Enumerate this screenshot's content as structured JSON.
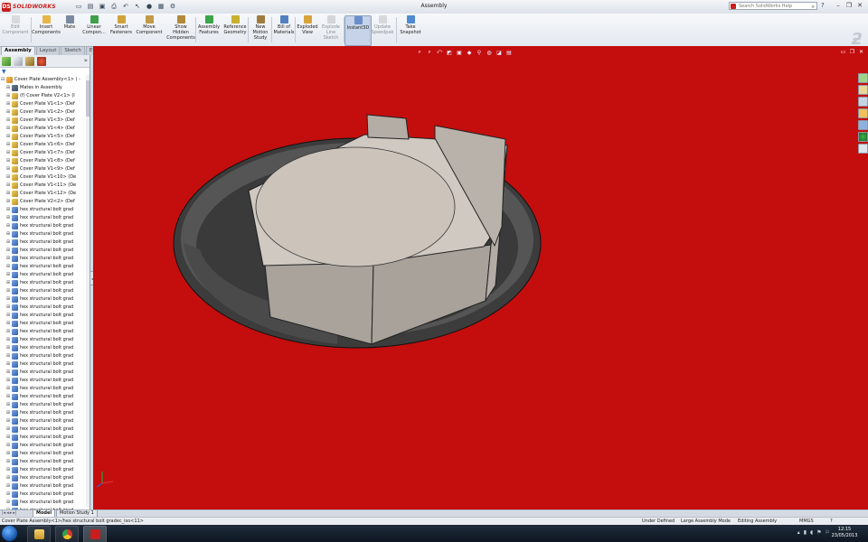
{
  "app": {
    "name": "SOLIDWORKS",
    "doc_title": "Assembly",
    "help_search_placeholder": "Search SolidWorks Help"
  },
  "commands": [
    {
      "id": "edit-component",
      "label": "Edit Component",
      "icon": "edit-component-icon",
      "disabled": true
    },
    {
      "id": "insert-components",
      "label": "Insert Components",
      "icon": "insert-components-icon"
    },
    {
      "id": "mate",
      "label": "Mate",
      "icon": "mate-icon"
    },
    {
      "id": "linear-component",
      "label": "Linear Compon...",
      "icon": "linear-pattern-icon"
    },
    {
      "id": "smart-fasteners",
      "label": "Smart Fasteners",
      "icon": "smart-fasteners-icon"
    },
    {
      "id": "move-component",
      "label": "Move Component",
      "icon": "move-component-icon"
    },
    {
      "id": "show-hidden",
      "label": "Show Hidden Components",
      "icon": "show-hidden-icon"
    },
    {
      "id": "assembly-features",
      "label": "Assembly Features",
      "icon": "assembly-features-icon"
    },
    {
      "id": "reference-geometry",
      "label": "Reference Geometry",
      "icon": "reference-geometry-icon"
    },
    {
      "id": "new-motion-study",
      "label": "New Motion Study",
      "icon": "motion-study-icon"
    },
    {
      "id": "bill-of-materials",
      "label": "Bill of Materials",
      "icon": "bom-icon"
    },
    {
      "id": "exploded-view",
      "label": "Exploded View",
      "icon": "exploded-view-icon"
    },
    {
      "id": "explode-line-sketch",
      "label": "Explode Line Sketch",
      "icon": "explode-line-icon",
      "disabled": true
    },
    {
      "id": "instant3d",
      "label": "Instant3D",
      "icon": "instant3d-icon",
      "active": true
    },
    {
      "id": "update-speedpak",
      "label": "Update Speedpak",
      "icon": "speedpak-icon",
      "disabled": true
    },
    {
      "id": "take-snapshot",
      "label": "Take Snapshot",
      "icon": "snapshot-icon"
    }
  ],
  "tabs": [
    "Assembly",
    "Layout",
    "Sketch",
    "Evaluate",
    "Office Products"
  ],
  "tree": {
    "root": "Cover Plate Assembly<1> ( -",
    "items": [
      {
        "label": "Mates in Assembly",
        "type": "mates"
      },
      {
        "label": "(f) Cover Plate V2<1> (I",
        "type": "part"
      },
      {
        "label": "Cover Plate V1<1> (Def",
        "type": "part"
      },
      {
        "label": "Cover Plate V1<2> (Def",
        "type": "part"
      },
      {
        "label": "Cover Plate V1<3> (Def",
        "type": "part"
      },
      {
        "label": "Cover Plate V1<4> (Def",
        "type": "part"
      },
      {
        "label": "Cover Plate V1<5> (Def",
        "type": "part"
      },
      {
        "label": "Cover Plate V1<6> (Def",
        "type": "part"
      },
      {
        "label": "Cover Plate V1<7> (Def",
        "type": "part"
      },
      {
        "label": "Cover Plate V1<8> (Def",
        "type": "part"
      },
      {
        "label": "Cover Plate V1<9> (Def",
        "type": "part"
      },
      {
        "label": "Cover Plate V1<10> (De",
        "type": "part"
      },
      {
        "label": "Cover Plate V1<11> (De",
        "type": "part"
      },
      {
        "label": "Cover Plate V1<12> (De",
        "type": "part"
      },
      {
        "label": "Cover Plate V2<2> (Def",
        "type": "part"
      },
      {
        "label": "hex structural bolt grad",
        "type": "bolt"
      },
      {
        "label": "hex structural bolt grad",
        "type": "bolt"
      },
      {
        "label": "hex structural bolt grad",
        "type": "bolt"
      },
      {
        "label": "hex structural bolt grad",
        "type": "bolt"
      },
      {
        "label": "hex structural bolt grad",
        "type": "bolt"
      },
      {
        "label": "hex structural bolt grad",
        "type": "bolt"
      },
      {
        "label": "hex structural bolt grad",
        "type": "bolt"
      },
      {
        "label": "hex structural bolt grad",
        "type": "bolt"
      },
      {
        "label": "hex structural bolt grad",
        "type": "bolt"
      },
      {
        "label": "hex structural bolt grad",
        "type": "bolt"
      },
      {
        "label": "hex structural bolt grad",
        "type": "bolt"
      },
      {
        "label": "hex structural bolt grad",
        "type": "bolt"
      },
      {
        "label": "hex structural bolt grad",
        "type": "bolt"
      },
      {
        "label": "hex structural bolt grad",
        "type": "bolt"
      },
      {
        "label": "hex structural bolt grad",
        "type": "bolt"
      },
      {
        "label": "hex structural bolt grad",
        "type": "bolt"
      },
      {
        "label": "hex structural bolt grad",
        "type": "bolt"
      },
      {
        "label": "hex structural bolt grad",
        "type": "bolt"
      },
      {
        "label": "hex structural bolt grad",
        "type": "bolt"
      },
      {
        "label": "hex structural bolt grad",
        "type": "bolt"
      },
      {
        "label": "hex structural bolt grad",
        "type": "bolt"
      },
      {
        "label": "hex structural bolt grad",
        "type": "bolt"
      },
      {
        "label": "hex structural bolt grad",
        "type": "bolt"
      },
      {
        "label": "hex structural bolt grad",
        "type": "bolt"
      },
      {
        "label": "hex structural bolt grad",
        "type": "bolt"
      },
      {
        "label": "hex structural bolt grad",
        "type": "bolt"
      },
      {
        "label": "hex structural bolt grad",
        "type": "bolt"
      },
      {
        "label": "hex structural bolt grad",
        "type": "bolt"
      },
      {
        "label": "hex structural bolt grad",
        "type": "bolt"
      },
      {
        "label": "hex structural bolt grad",
        "type": "bolt"
      },
      {
        "label": "hex structural bolt grad",
        "type": "bolt"
      },
      {
        "label": "hex structural bolt grad",
        "type": "bolt"
      },
      {
        "label": "hex structural bolt grad",
        "type": "bolt"
      },
      {
        "label": "hex structural bolt grad",
        "type": "bolt"
      },
      {
        "label": "hex structural bolt grad",
        "type": "bolt"
      },
      {
        "label": "hex structural bolt grad",
        "type": "bolt"
      },
      {
        "label": "hex structural bolt grad",
        "type": "bolt"
      },
      {
        "label": "hex structural bolt grad",
        "type": "bolt"
      }
    ]
  },
  "bottom_tabs": [
    "Model",
    "Motion Study 1"
  ],
  "status": {
    "left": "Cover Plate Assembly<1>/hex structural bolt gradec_iso<11>",
    "state": "Under Defined",
    "mode": "Large Assembly Mode",
    "editing": "Editing Assembly",
    "units": "MMGS",
    "help": "?"
  },
  "clock": {
    "time": "12:15",
    "date": "23/05/2013"
  },
  "colors": {
    "viewport_bg": "#c40d0d",
    "accent": "#c81e1e"
  }
}
